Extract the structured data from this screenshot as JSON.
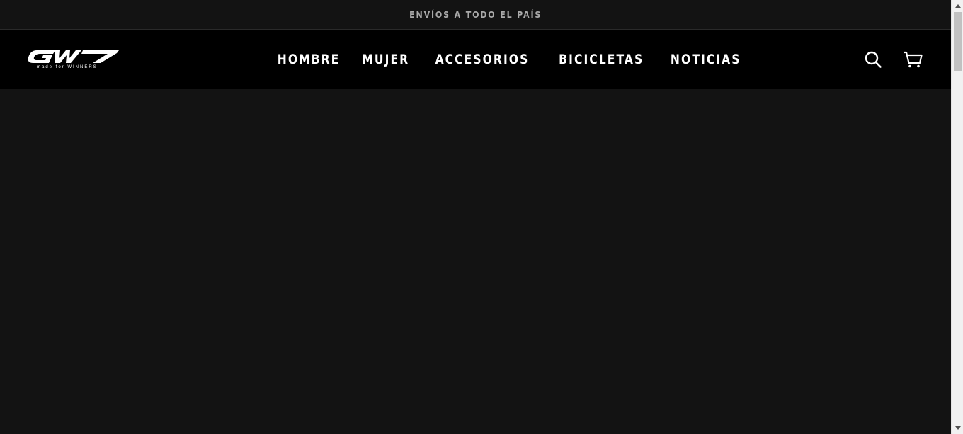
{
  "announcement": {
    "text": "ENVÍOS A TODO EL PAÍS"
  },
  "header": {
    "logo": {
      "main": "GW",
      "tagline": "made for WINNERS"
    },
    "nav": [
      {
        "label": "HOMBRE"
      },
      {
        "label": "MUJER"
      },
      {
        "label": "ACCESORIOS"
      },
      {
        "label": "BICICLETAS"
      },
      {
        "label": "NOTICIAS"
      }
    ],
    "icons": {
      "search": "search-icon",
      "cart": "cart-icon"
    }
  },
  "colors": {
    "background": "#131313",
    "header_background": "#000000",
    "announcement_text": "#a9a9a9",
    "nav_text": "#ffffff"
  }
}
